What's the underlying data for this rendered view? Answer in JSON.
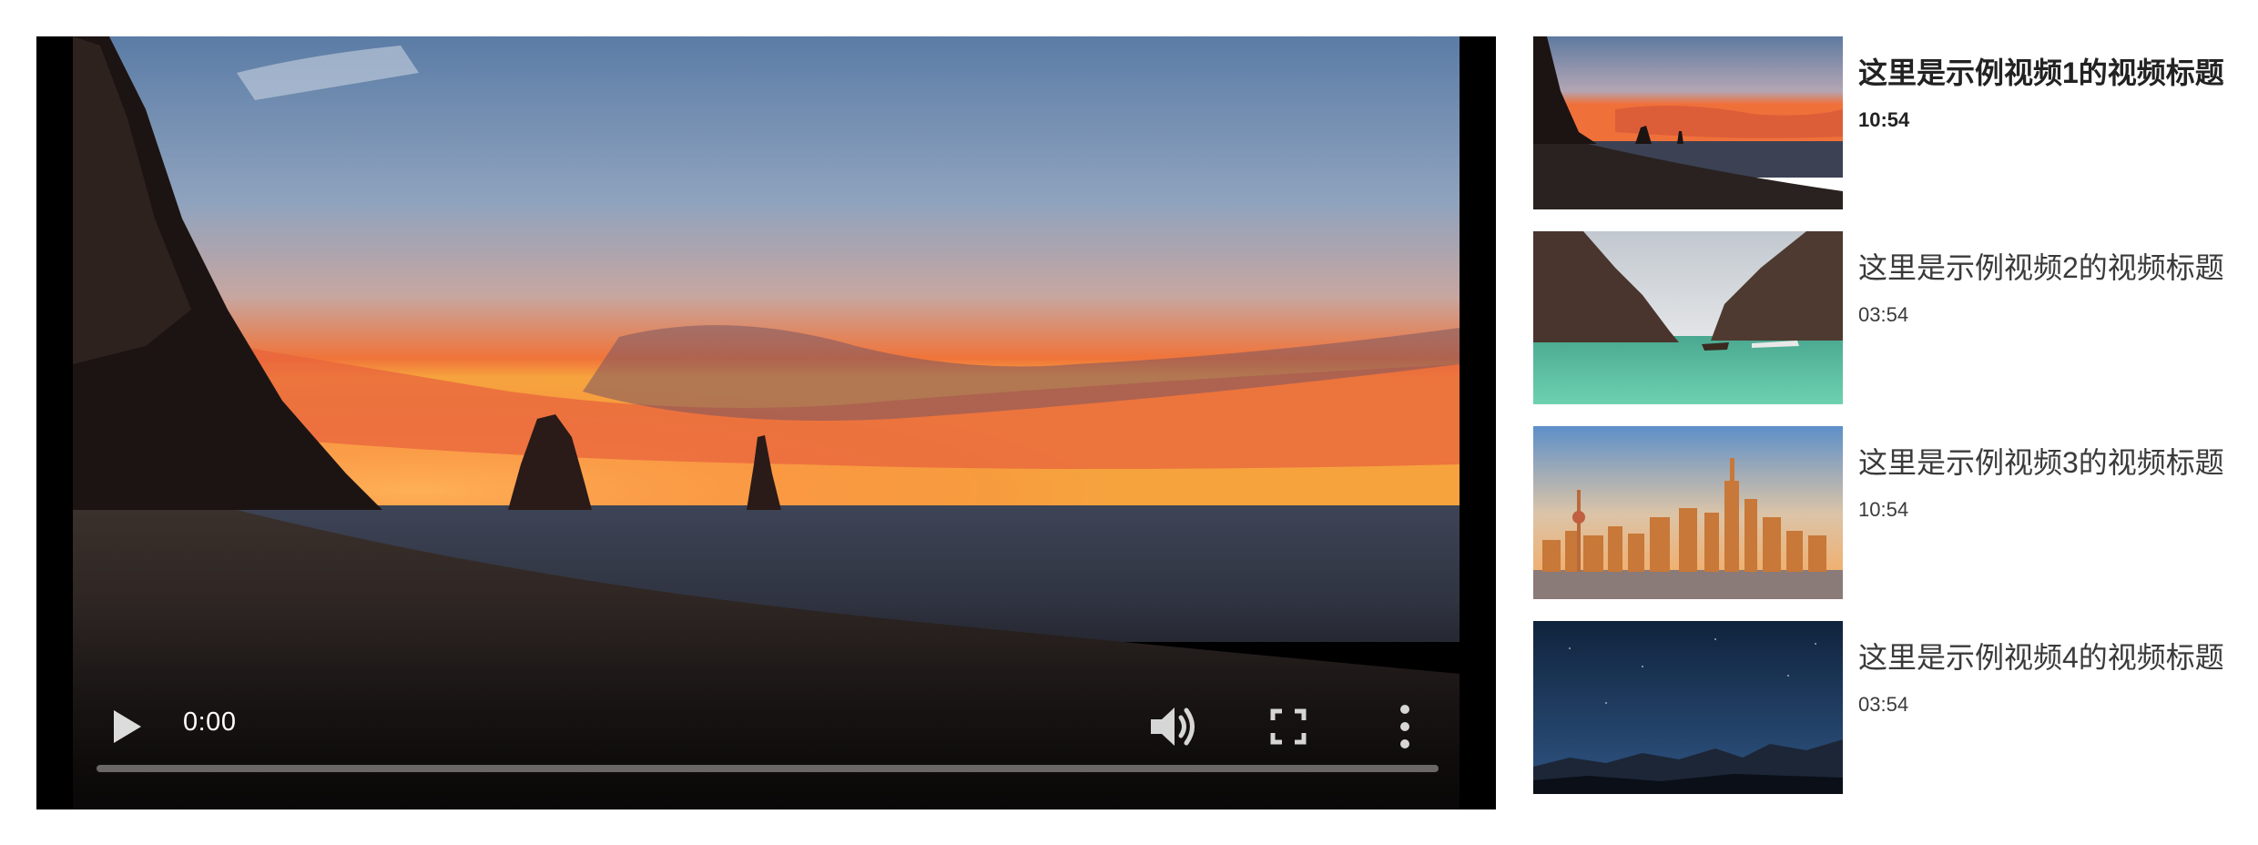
{
  "player": {
    "current_time": "0:00",
    "progress": 0,
    "icons": {
      "play": "play-icon",
      "volume": "volume-icon",
      "fullscreen": "fullscreen-icon",
      "menu": "more-vertical-icon"
    }
  },
  "playlist": {
    "items": [
      {
        "title": "这里是示例视频1的视频标题",
        "duration": "10:54",
        "active": true,
        "thumbnail": "beach-sunset"
      },
      {
        "title": "这里是示例视频2的视频标题",
        "duration": "03:54",
        "active": false,
        "thumbnail": "lagoon-cliffs"
      },
      {
        "title": "这里是示例视频3的视频标题",
        "duration": "10:54",
        "active": false,
        "thumbnail": "city-skyline"
      },
      {
        "title": "这里是示例视频4的视频标题",
        "duration": "03:54",
        "active": false,
        "thumbnail": "night-mountains"
      }
    ]
  },
  "colors": {
    "player_background": "#000000",
    "control_icon": "#e0e0e0",
    "progress_track": "#9a9a9a",
    "title_text": "#3a3a3a"
  }
}
